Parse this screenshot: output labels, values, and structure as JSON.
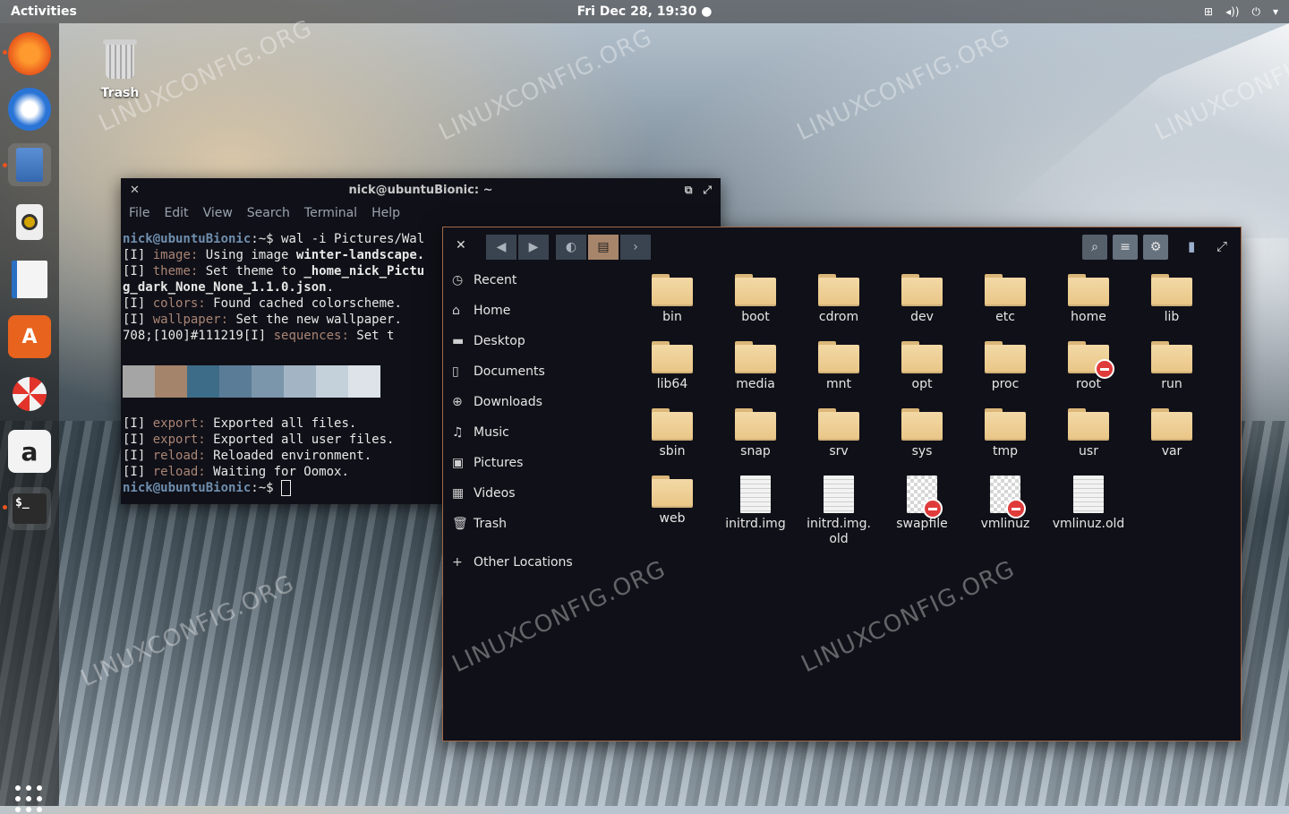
{
  "topbar": {
    "activities": "Activities",
    "clock": "Fri Dec 28, 19:30"
  },
  "dock": {
    "apps": [
      "firefox-icon",
      "thunderbird-icon",
      "files-icon",
      "rhythmbox-icon",
      "writer-icon",
      "software-icon",
      "help-icon",
      "amazon-icon",
      "terminal-icon"
    ]
  },
  "desktop": {
    "trash_label": "Trash"
  },
  "terminal": {
    "title": "nick@ubuntuBionic: ~",
    "menu": [
      "File",
      "Edit",
      "View",
      "Search",
      "Terminal",
      "Help"
    ],
    "prompt": "nick@ubuntuBionic",
    "command": ":~$ wal -i Pictures/Wal",
    "lines": {
      "l1_tag": "[I]",
      "l1_key": " image:",
      "l1_text": " Using image ",
      "l1_bold": "winter-landscape.",
      "l2_tag": "[I]",
      "l2_key": " theme:",
      "l2_text": " Set theme to ",
      "l2_bold": "_home_nick_Pictu",
      "l3_bold": "g_dark_None_None_1.1.0.json",
      "l3_text": ".",
      "l4_tag": "[I]",
      "l4_key": " colors:",
      "l4_text": " Found cached colorscheme.",
      "l5_tag": "[I]",
      "l5_key": " wallpaper:",
      "l5_text": " Set the new wallpaper.",
      "l6_text": "708;[100]#111219",
      "l6_tag": "[I]",
      "l6_key": " sequences:",
      "l6_tail": " Set t",
      "l7_tag": "[I]",
      "l7_key": " export:",
      "l7_text": " Exported all files.",
      "l8_tag": "[I]",
      "l8_key": " export:",
      "l8_text": " Exported all user files.",
      "l9_tag": "[I]",
      "l9_key": " reload:",
      "l9_text": " Reloaded environment.",
      "l10_tag": "[I]",
      "l10_key": " reload:",
      "l10_text": " Waiting for Oomox.",
      "final_prompt": "nick@ubuntuBionic",
      "final_suffix": ":~$ "
    },
    "swatch_colors": [
      "#a5a5a5",
      "#a4846a",
      "#3d6c88",
      "#5b7c97",
      "#7b95ab",
      "#a3b4c4",
      "#c4d0da",
      "#dde3e8"
    ]
  },
  "files": {
    "sidebar": [
      {
        "icon": "recent-icon",
        "label": "Recent"
      },
      {
        "icon": "home-icon",
        "label": "Home"
      },
      {
        "icon": "folder-icon",
        "label": "Desktop"
      },
      {
        "icon": "document-icon",
        "label": "Documents"
      },
      {
        "icon": "download-icon",
        "label": "Downloads"
      },
      {
        "icon": "music-icon",
        "label": "Music"
      },
      {
        "icon": "pictures-icon",
        "label": "Pictures"
      },
      {
        "icon": "videos-icon",
        "label": "Videos"
      },
      {
        "icon": "trash-icon",
        "label": "Trash"
      }
    ],
    "other_locations": "Other Locations",
    "items": [
      {
        "name": "bin",
        "type": "folder"
      },
      {
        "name": "boot",
        "type": "folder"
      },
      {
        "name": "cdrom",
        "type": "folder"
      },
      {
        "name": "dev",
        "type": "folder"
      },
      {
        "name": "etc",
        "type": "folder"
      },
      {
        "name": "home",
        "type": "folder"
      },
      {
        "name": "lib",
        "type": "folder"
      },
      {
        "name": "lib64",
        "type": "folder"
      },
      {
        "name": "media",
        "type": "folder"
      },
      {
        "name": "mnt",
        "type": "folder"
      },
      {
        "name": "opt",
        "type": "folder"
      },
      {
        "name": "proc",
        "type": "folder"
      },
      {
        "name": "root",
        "type": "folder-locked"
      },
      {
        "name": "run",
        "type": "folder"
      },
      {
        "name": "sbin",
        "type": "folder"
      },
      {
        "name": "snap",
        "type": "folder"
      },
      {
        "name": "srv",
        "type": "folder"
      },
      {
        "name": "sys",
        "type": "folder"
      },
      {
        "name": "tmp",
        "type": "folder"
      },
      {
        "name": "usr",
        "type": "folder"
      },
      {
        "name": "var",
        "type": "folder"
      },
      {
        "name": "web",
        "type": "folder"
      },
      {
        "name": "initrd.img",
        "type": "file"
      },
      {
        "name": "initrd.img.\nold",
        "type": "file"
      },
      {
        "name": "swapfile",
        "type": "file-locked"
      },
      {
        "name": "vmlinuz",
        "type": "file-locked-link"
      },
      {
        "name": "vmlinuz.old",
        "type": "file"
      }
    ]
  },
  "watermark": "LINUXCONFIG.ORG"
}
